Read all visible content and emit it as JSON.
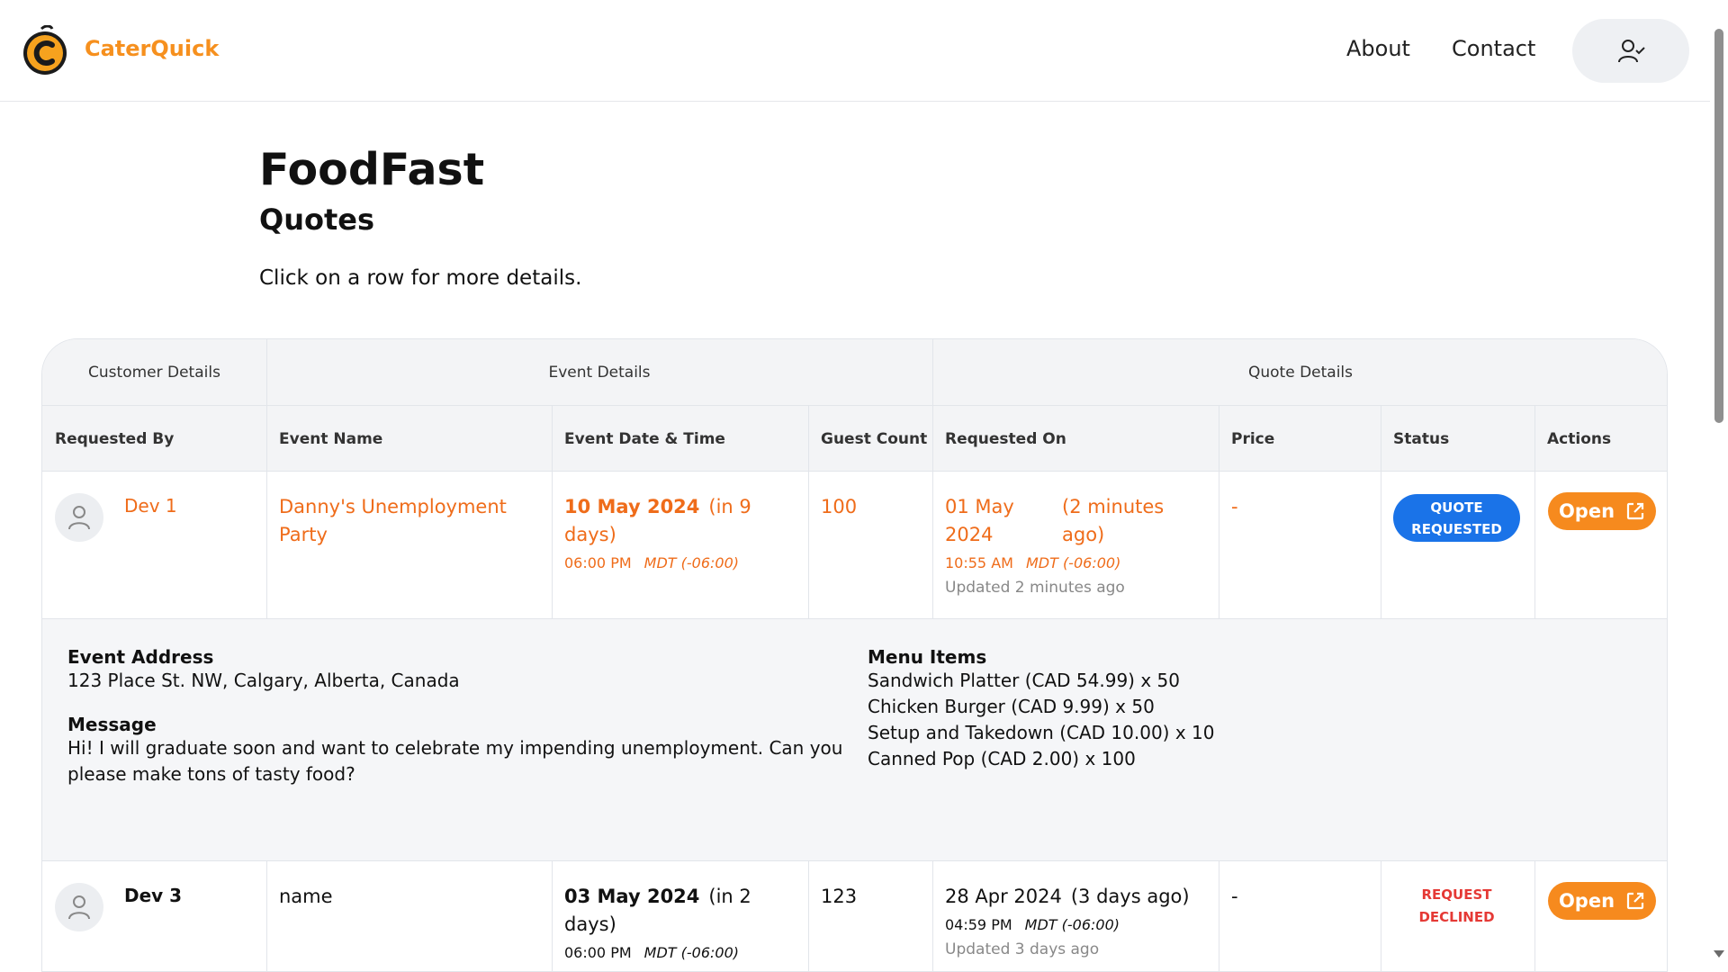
{
  "header": {
    "brand": "CaterQuick",
    "nav": {
      "about": "About",
      "contact": "Contact"
    },
    "user_icon": "user-check-icon",
    "brand_color": "#f6901e"
  },
  "page": {
    "title": "FoodFast",
    "subtitle": "Quotes",
    "hint": "Click on a row for more details."
  },
  "table": {
    "groups": {
      "customer": "Customer Details",
      "event": "Event Details",
      "quote": "Quote Details"
    },
    "columns": {
      "requested_by": "Requested By",
      "event_name": "Event Name",
      "event_datetime": "Event Date & Time",
      "guest_count": "Guest Count",
      "requested_on": "Requested On",
      "price": "Price",
      "status": "Status",
      "actions": "Actions"
    },
    "rows": [
      {
        "requested_by": "Dev 1",
        "event_name": "Danny's Unemployment Party",
        "event_date": "10 May 2024",
        "event_relative": "(in 9 days)",
        "event_time": "06:00 PM",
        "event_tz": "MDT (-06:00)",
        "guest_count": "100",
        "requested_date": "01 May 2024",
        "requested_relative": "(2 minutes ago)",
        "requested_time": "10:55 AM",
        "requested_tz": "MDT (-06:00)",
        "updated": "Updated 2 minutes ago",
        "price": "-",
        "status": "QUOTE REQUESTED",
        "action": "Open",
        "accent": "#ef6c1a"
      },
      {
        "requested_by": "Dev 3",
        "event_name": "name",
        "event_date": "03 May 2024",
        "event_relative": "(in 2 days)",
        "event_time": "06:00 PM",
        "event_tz": "MDT (-06:00)",
        "guest_count": "123",
        "requested_date": "28 Apr 2024",
        "requested_relative": "(3 days ago)",
        "requested_time": "04:59 PM",
        "requested_tz": "MDT (-06:00)",
        "updated": "Updated 3 days ago",
        "price": "-",
        "status": "REQUEST DECLINED",
        "action": "Open",
        "status_color": "#e53935"
      }
    ],
    "details": {
      "address_label": "Event Address",
      "address": "123 Place St. NW, Calgary, Alberta, Canada",
      "message_label": "Message",
      "message": "Hi! I will graduate soon and want to celebrate my impending unemployment. Can you please make tons of tasty food?",
      "menu_label": "Menu Items",
      "menu_items": [
        "Sandwich Platter (CAD 54.99) x 50",
        "Chicken Burger (CAD 9.99) x 50",
        "Setup and Takedown (CAD 10.00) x 10",
        "Canned Pop (CAD 2.00) x 100"
      ]
    },
    "status_colors": {
      "quote_requested": "#1a73e8",
      "declined": "#e53935",
      "open_button": "#f68a1e"
    }
  }
}
